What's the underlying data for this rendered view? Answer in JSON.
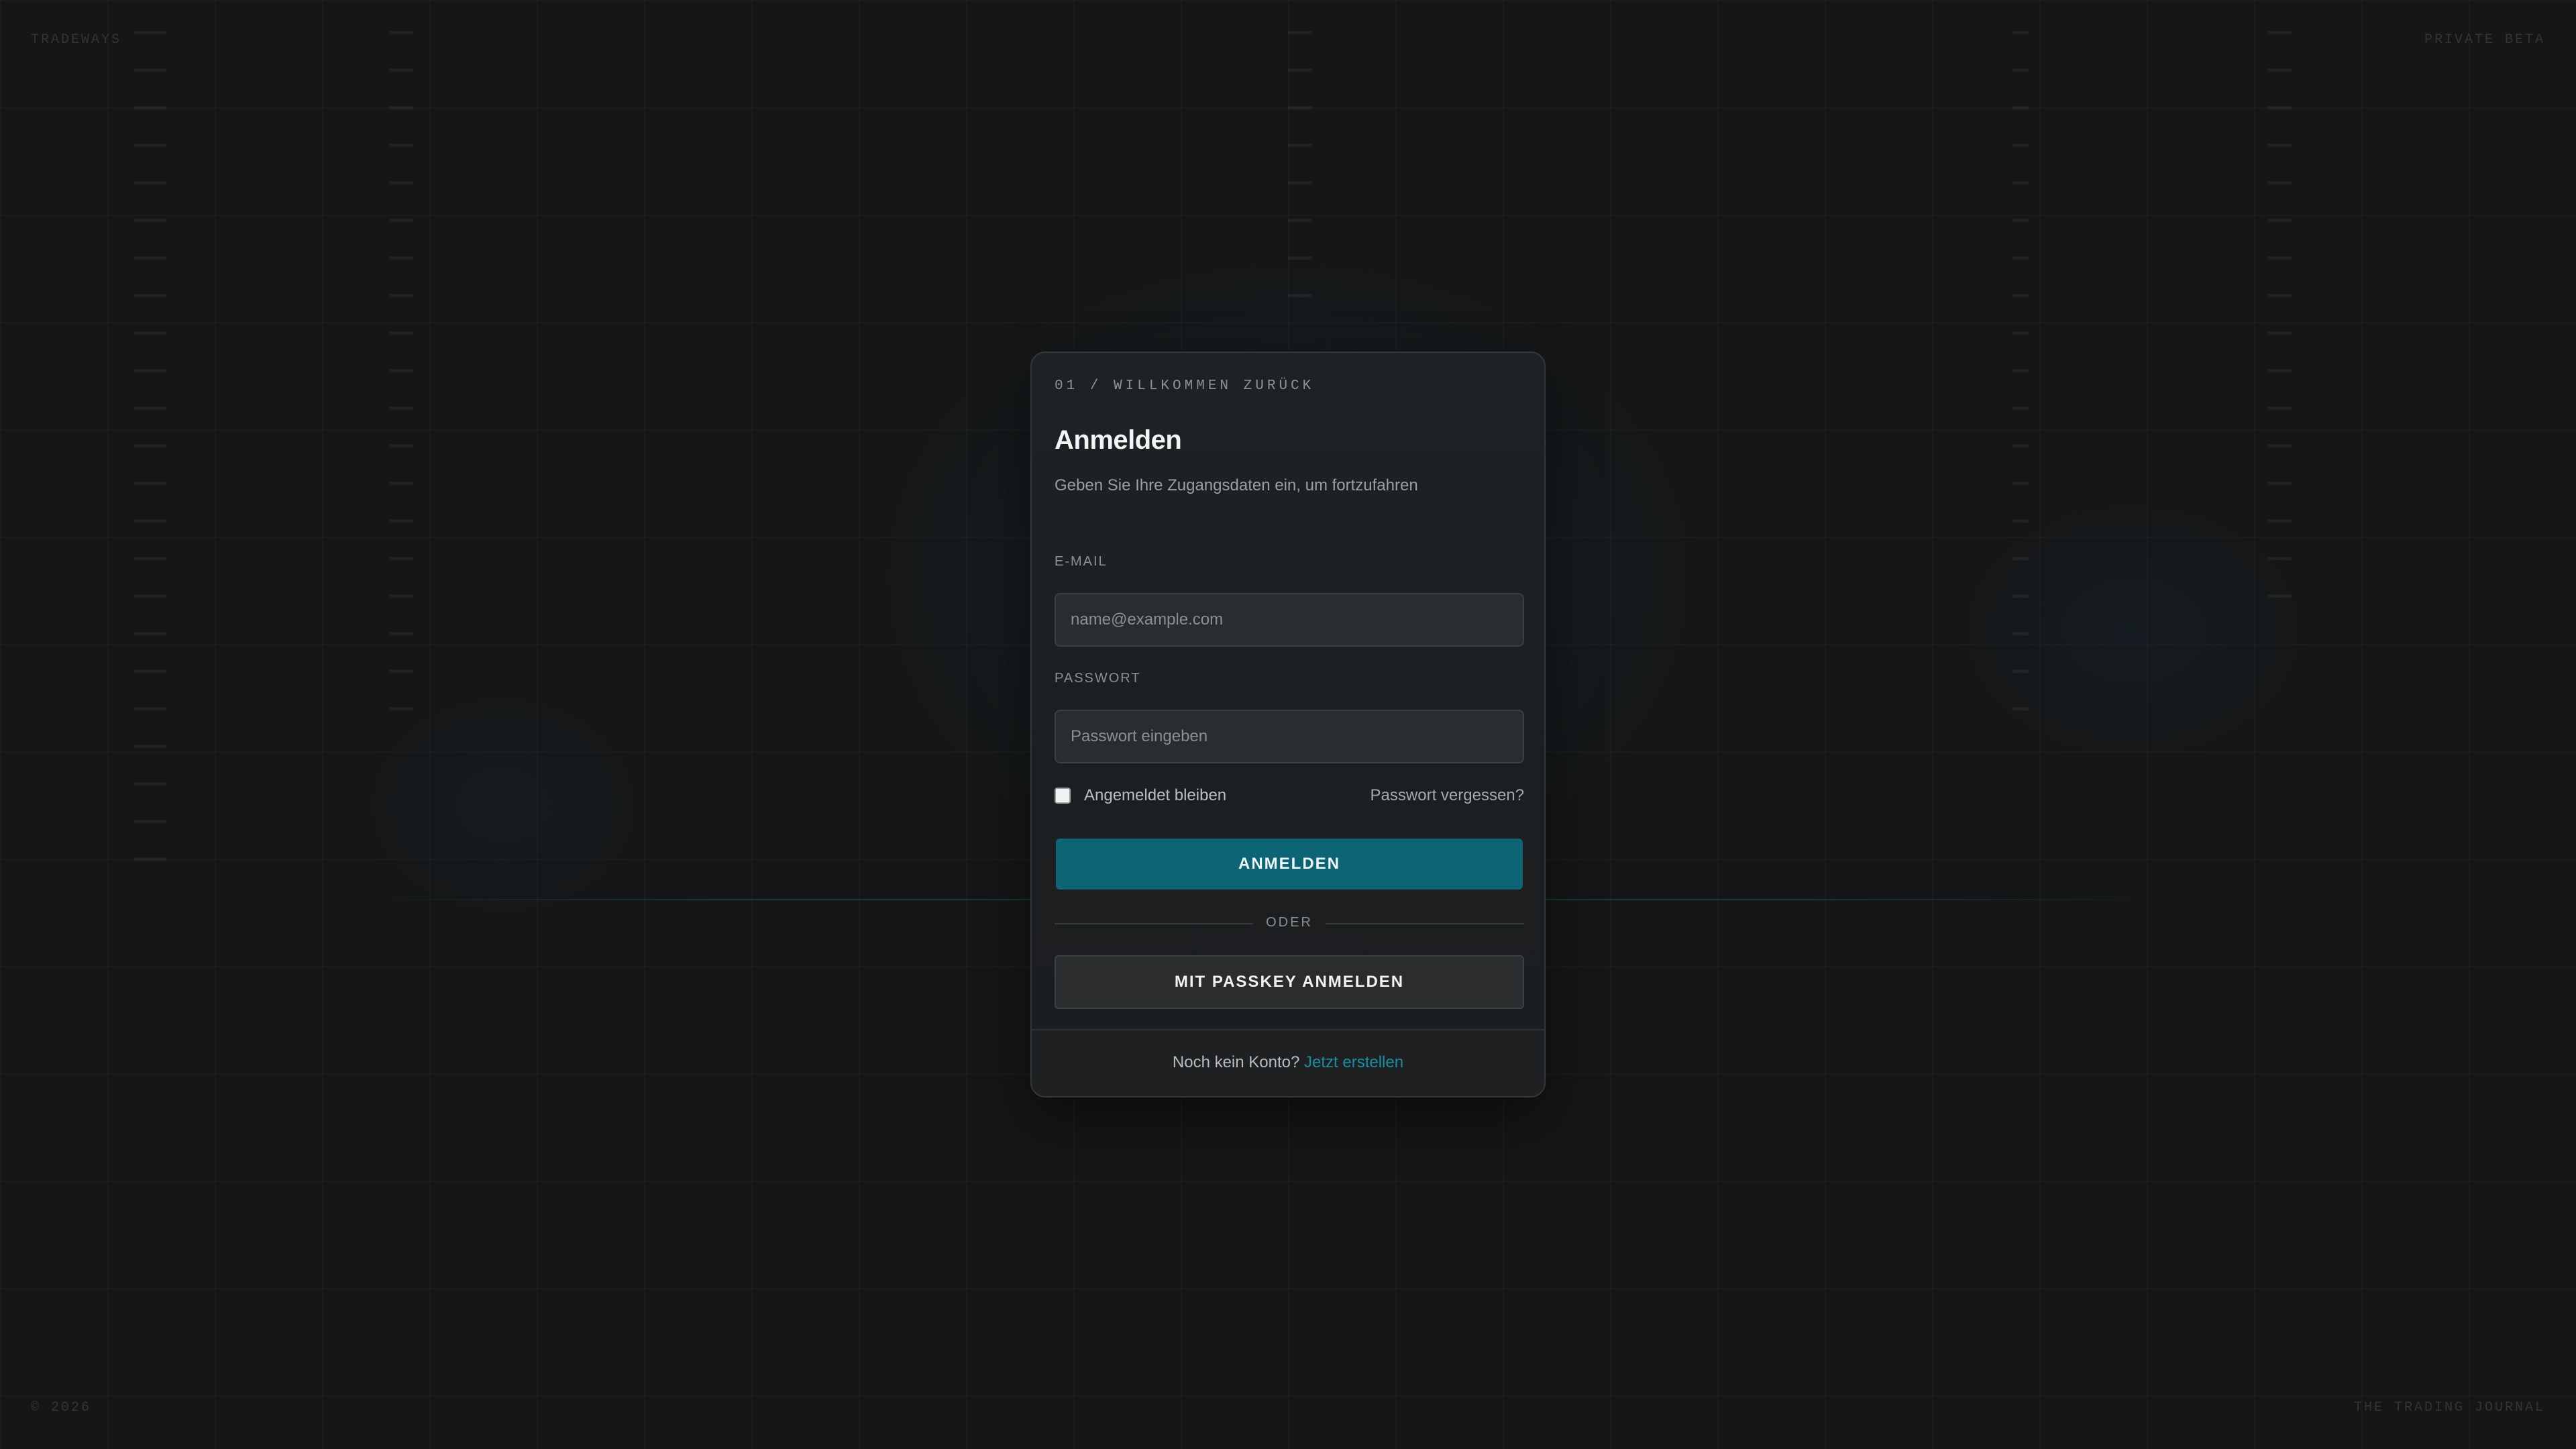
{
  "corners": {
    "brand": "TRADEWAYS",
    "beta": "PRIVATE BETA",
    "copyright": "© 2026",
    "tagline": "THE TRADING JOURNAL"
  },
  "login": {
    "eyebrow": "01 / WILLKOMMEN ZURÜCK",
    "title": "Anmelden",
    "subtitle": "Geben Sie Ihre Zugangsdaten ein, um fortzufahren",
    "email": {
      "label": "E-MAIL",
      "placeholder": "name@example.com",
      "value": ""
    },
    "password": {
      "label": "PASSWORT",
      "placeholder": "Passwort eingeben",
      "value": ""
    },
    "remember": {
      "label": "Angemeldet bleiben",
      "checked": false
    },
    "forgot_label": "Passwort vergessen?",
    "submit_label": "ANMELDEN",
    "divider_label": "ODER",
    "passkey_label": "MIT PASSKEY ANMELDEN",
    "footer": {
      "prompt": "Noch kein Konto? ",
      "link": "Jetzt erstellen"
    }
  },
  "colors": {
    "accent": "#0d6474",
    "link": "#1b8fa3",
    "background": "#151617",
    "card": "#1c1f21"
  }
}
